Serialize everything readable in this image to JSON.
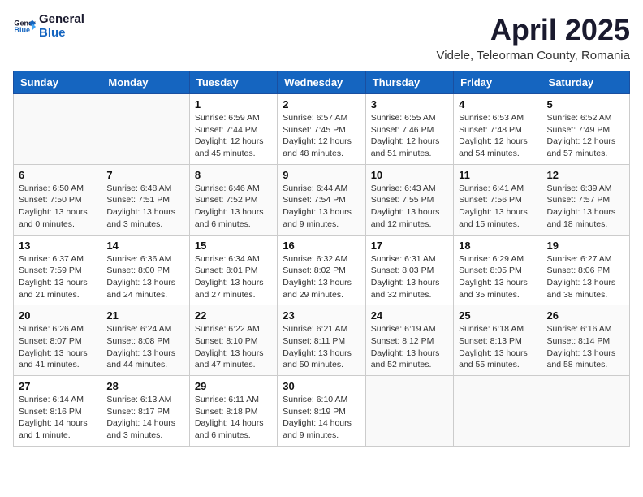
{
  "logo": {
    "text_general": "General",
    "text_blue": "Blue"
  },
  "title": "April 2025",
  "subtitle": "Videle, Teleorman County, Romania",
  "weekdays": [
    "Sunday",
    "Monday",
    "Tuesday",
    "Wednesday",
    "Thursday",
    "Friday",
    "Saturday"
  ],
  "weeks": [
    [
      {
        "day": "",
        "info": ""
      },
      {
        "day": "",
        "info": ""
      },
      {
        "day": "1",
        "info": "Sunrise: 6:59 AM\nSunset: 7:44 PM\nDaylight: 12 hours\nand 45 minutes."
      },
      {
        "day": "2",
        "info": "Sunrise: 6:57 AM\nSunset: 7:45 PM\nDaylight: 12 hours\nand 48 minutes."
      },
      {
        "day": "3",
        "info": "Sunrise: 6:55 AM\nSunset: 7:46 PM\nDaylight: 12 hours\nand 51 minutes."
      },
      {
        "day": "4",
        "info": "Sunrise: 6:53 AM\nSunset: 7:48 PM\nDaylight: 12 hours\nand 54 minutes."
      },
      {
        "day": "5",
        "info": "Sunrise: 6:52 AM\nSunset: 7:49 PM\nDaylight: 12 hours\nand 57 minutes."
      }
    ],
    [
      {
        "day": "6",
        "info": "Sunrise: 6:50 AM\nSunset: 7:50 PM\nDaylight: 13 hours\nand 0 minutes."
      },
      {
        "day": "7",
        "info": "Sunrise: 6:48 AM\nSunset: 7:51 PM\nDaylight: 13 hours\nand 3 minutes."
      },
      {
        "day": "8",
        "info": "Sunrise: 6:46 AM\nSunset: 7:52 PM\nDaylight: 13 hours\nand 6 minutes."
      },
      {
        "day": "9",
        "info": "Sunrise: 6:44 AM\nSunset: 7:54 PM\nDaylight: 13 hours\nand 9 minutes."
      },
      {
        "day": "10",
        "info": "Sunrise: 6:43 AM\nSunset: 7:55 PM\nDaylight: 13 hours\nand 12 minutes."
      },
      {
        "day": "11",
        "info": "Sunrise: 6:41 AM\nSunset: 7:56 PM\nDaylight: 13 hours\nand 15 minutes."
      },
      {
        "day": "12",
        "info": "Sunrise: 6:39 AM\nSunset: 7:57 PM\nDaylight: 13 hours\nand 18 minutes."
      }
    ],
    [
      {
        "day": "13",
        "info": "Sunrise: 6:37 AM\nSunset: 7:59 PM\nDaylight: 13 hours\nand 21 minutes."
      },
      {
        "day": "14",
        "info": "Sunrise: 6:36 AM\nSunset: 8:00 PM\nDaylight: 13 hours\nand 24 minutes."
      },
      {
        "day": "15",
        "info": "Sunrise: 6:34 AM\nSunset: 8:01 PM\nDaylight: 13 hours\nand 27 minutes."
      },
      {
        "day": "16",
        "info": "Sunrise: 6:32 AM\nSunset: 8:02 PM\nDaylight: 13 hours\nand 29 minutes."
      },
      {
        "day": "17",
        "info": "Sunrise: 6:31 AM\nSunset: 8:03 PM\nDaylight: 13 hours\nand 32 minutes."
      },
      {
        "day": "18",
        "info": "Sunrise: 6:29 AM\nSunset: 8:05 PM\nDaylight: 13 hours\nand 35 minutes."
      },
      {
        "day": "19",
        "info": "Sunrise: 6:27 AM\nSunset: 8:06 PM\nDaylight: 13 hours\nand 38 minutes."
      }
    ],
    [
      {
        "day": "20",
        "info": "Sunrise: 6:26 AM\nSunset: 8:07 PM\nDaylight: 13 hours\nand 41 minutes."
      },
      {
        "day": "21",
        "info": "Sunrise: 6:24 AM\nSunset: 8:08 PM\nDaylight: 13 hours\nand 44 minutes."
      },
      {
        "day": "22",
        "info": "Sunrise: 6:22 AM\nSunset: 8:10 PM\nDaylight: 13 hours\nand 47 minutes."
      },
      {
        "day": "23",
        "info": "Sunrise: 6:21 AM\nSunset: 8:11 PM\nDaylight: 13 hours\nand 50 minutes."
      },
      {
        "day": "24",
        "info": "Sunrise: 6:19 AM\nSunset: 8:12 PM\nDaylight: 13 hours\nand 52 minutes."
      },
      {
        "day": "25",
        "info": "Sunrise: 6:18 AM\nSunset: 8:13 PM\nDaylight: 13 hours\nand 55 minutes."
      },
      {
        "day": "26",
        "info": "Sunrise: 6:16 AM\nSunset: 8:14 PM\nDaylight: 13 hours\nand 58 minutes."
      }
    ],
    [
      {
        "day": "27",
        "info": "Sunrise: 6:14 AM\nSunset: 8:16 PM\nDaylight: 14 hours\nand 1 minute."
      },
      {
        "day": "28",
        "info": "Sunrise: 6:13 AM\nSunset: 8:17 PM\nDaylight: 14 hours\nand 3 minutes."
      },
      {
        "day": "29",
        "info": "Sunrise: 6:11 AM\nSunset: 8:18 PM\nDaylight: 14 hours\nand 6 minutes."
      },
      {
        "day": "30",
        "info": "Sunrise: 6:10 AM\nSunset: 8:19 PM\nDaylight: 14 hours\nand 9 minutes."
      },
      {
        "day": "",
        "info": ""
      },
      {
        "day": "",
        "info": ""
      },
      {
        "day": "",
        "info": ""
      }
    ]
  ]
}
